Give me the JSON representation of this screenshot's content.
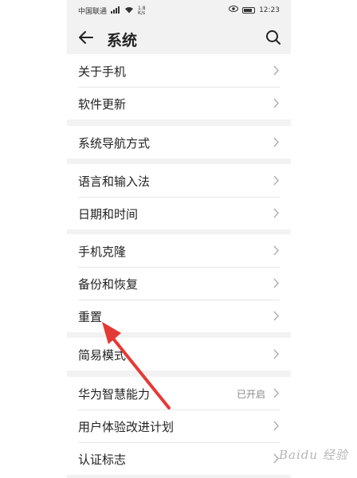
{
  "status_bar": {
    "carrier": "中国联通",
    "net_speed": "1.8\nK/s",
    "time": "12:23",
    "battery_level": 0.8
  },
  "header": {
    "title": "系统",
    "back_icon": "arrow-left-icon",
    "search_icon": "search-icon"
  },
  "groups": [
    {
      "items": [
        {
          "label": "关于手机"
        },
        {
          "label": "软件更新"
        }
      ]
    },
    {
      "items": [
        {
          "label": "系统导航方式"
        }
      ]
    },
    {
      "items": [
        {
          "label": "语言和输入法"
        },
        {
          "label": "日期和时间"
        }
      ]
    },
    {
      "items": [
        {
          "label": "手机克隆"
        },
        {
          "label": "备份和恢复"
        },
        {
          "label": "重置"
        }
      ]
    },
    {
      "items": [
        {
          "label": "简易模式"
        }
      ]
    },
    {
      "items": [
        {
          "label": "华为智慧能力",
          "value": "已开启"
        },
        {
          "label": "用户体验改进计划"
        },
        {
          "label": "认证标志"
        }
      ]
    }
  ],
  "annotation": {
    "color": "#e53935",
    "target": "重置"
  },
  "watermark": "Baidu 经验"
}
